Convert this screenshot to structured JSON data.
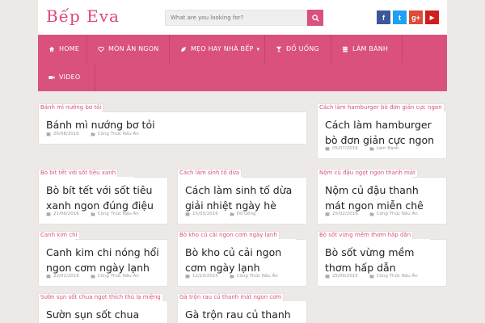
{
  "header": {
    "logo": "Bếp Eva",
    "search_placeholder": "What are you looking for?",
    "social": [
      {
        "name": "facebook-icon",
        "glyph": "f",
        "color": "#3b5998"
      },
      {
        "name": "twitter-icon",
        "glyph": "t",
        "color": "#1da1f2"
      },
      {
        "name": "google-plus-icon",
        "glyph": "g+",
        "color": "#dd4b39"
      },
      {
        "name": "youtube-icon",
        "glyph": "▶",
        "color": "#cd201f"
      }
    ]
  },
  "nav": {
    "home": "HOME",
    "mon_an_ngon": "MÓN ĂN NGON",
    "meo_hay": "MẸO HAY NHÀ BẾP",
    "do_uong": "ĐỒ UỐNG",
    "lam_banh": "LÀM BÁNH",
    "video": "VIDEO"
  },
  "posts": [
    {
      "tag": "Bánh mì nướng bơ tỏi",
      "title": "Bánh mì nướng bơ tỏi",
      "date": "26/08/2016",
      "category": "Công Thức Nấu Ăn"
    },
    {
      "tag": "Cách làm hamburger bò đơn giản cực ngon",
      "title": "Cách làm hamburger bò đơn giản cực ngon",
      "date": "05/07/2016",
      "category": "Làm Bánh"
    },
    {
      "tag": "Bò bít tết với sốt tiêu xanh",
      "title": "Bò bít tết với sốt tiêu xanh ngon đúng điệu",
      "date": "21/06/2016",
      "category": "Công Thức Nấu Ăn"
    },
    {
      "tag": "Cách làm sinh tố dừa",
      "title": "Cách làm sinh tố dừa giải nhiệt ngày hè",
      "date": "15/05/2016",
      "category": "Đồ Uống"
    },
    {
      "tag": "Nộm củ đậu ngọt ngon thanh mát",
      "title": "Nộm củ đậu thanh mát ngon miễn chê",
      "date": "25/02/2016",
      "category": "Công Thức Nấu Ăn"
    },
    {
      "tag": "Canh kim chi",
      "title": "Canh kim chi nóng hổi ngon cơm ngày lạnh",
      "date": "22/01/2016",
      "category": "Công Thức Nấu Ăn"
    },
    {
      "tag": "Bò kho củ cải ngon cơm ngày lạnh",
      "title": "Bò kho củ cải ngon cơm ngày lạnh",
      "date": "12/10/2015",
      "category": "Công Thức Nấu Ăn"
    },
    {
      "tag": "Bò sốt vừng mềm thơm hấp dẫn",
      "title": "Bò sốt vừng mềm thơm hấp dẫn",
      "date": "25/09/2015",
      "category": "Công Thức Nấu Ăn"
    },
    {
      "tag": "Sườn sụn sốt chua ngọt thích thú lạ miệng",
      "title": "Sườn sụn sốt chua ngọt"
    },
    {
      "tag": "Gà trộn rau củ thanh mát ngon cơm",
      "title": "Gà trộn rau củ thanh mát"
    }
  ]
}
